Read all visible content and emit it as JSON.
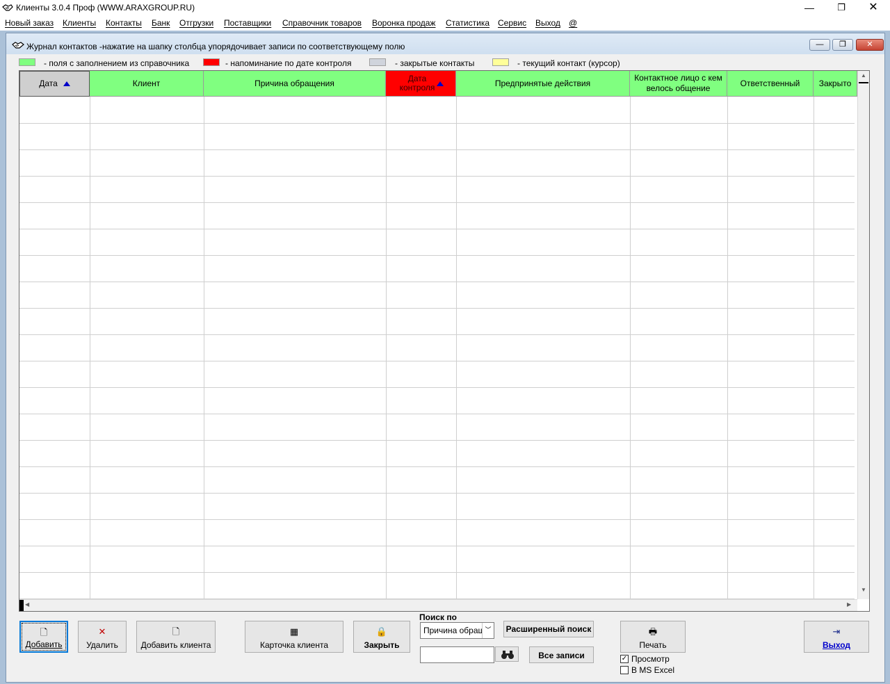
{
  "window": {
    "title": "Клиенты 3.0.4 Проф (WWW.ARAXGROUP.RU)",
    "controls": {
      "minimize": "—",
      "restore": "❐",
      "close": "✕"
    }
  },
  "menu": [
    "Новый заказ",
    "Клиенты",
    "Контакты",
    "Банк",
    "Отгрузки",
    "Поставщики",
    "Справочник товаров",
    "Воронка продаж",
    "Статистика",
    "Сервис",
    "Выход",
    "@"
  ],
  "child": {
    "title": "Журнал контактов -нажатие на шапку столбца упорядочивает записи по соответствующему полю"
  },
  "legend": [
    {
      "color": "#80ff80",
      "text": "- поля с заполнением из справочника"
    },
    {
      "color": "#ff0000",
      "text": "- напоминание по дате контроля"
    },
    {
      "color": "#d0d4dc",
      "text": "- закрытые контакты"
    },
    {
      "color": "#ffff99",
      "text": "- текущий контакт (курсор)"
    }
  ],
  "table": {
    "columns": [
      "Дата",
      "Клиент",
      "Причина обращения",
      "Дата контроля",
      "Предпринятые действия",
      "Контактное лицо с кем велось общение",
      "Ответственный",
      "Закрыто"
    ],
    "rows": []
  },
  "buttons": {
    "add": "Добавить",
    "delete": "Удалить",
    "add_client": "Добавить клиента",
    "client_card": "Карточка клиента",
    "close": "Закрыть",
    "advanced_search": "Расширенный поиск",
    "all_records": "Все записи",
    "print": "Печать",
    "exit": "Выход"
  },
  "search": {
    "label": "Поиск по",
    "field": "Причина обращения",
    "query": ""
  },
  "options": {
    "preview": {
      "label": "Просмотр",
      "checked": true
    },
    "excel": {
      "label": "В MS Excel",
      "checked": false
    }
  },
  "colors": {
    "lookup_field": "#80ff80",
    "reminder": "#ff0000",
    "closed": "#d0d4dc",
    "cursor": "#ffff99",
    "sort_arrow": "#0000c8"
  }
}
